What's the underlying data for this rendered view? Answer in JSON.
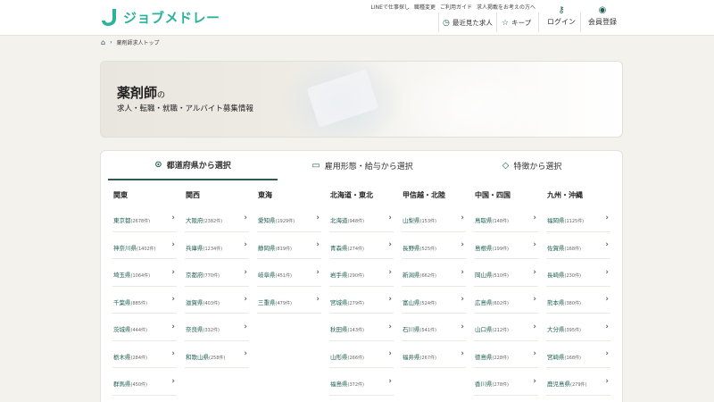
{
  "header": {
    "logo_text": "ジョブメドレー",
    "top_links": [
      "LINEで仕事探し",
      "職種変更",
      "ご利用ガイド",
      "求人掲載をお考えの方へ"
    ],
    "recent_label": "最近見た求人",
    "keep_label": "キープ",
    "login_label": "ログイン",
    "register_label": "会員登録"
  },
  "breadcrumb": {
    "current": "薬剤師求人トップ"
  },
  "hero": {
    "title": "薬剤師",
    "title_suffix": "の",
    "subtitle": "求人・転職・就職・アルバイト募集情報"
  },
  "tabs": [
    {
      "label": "都道府県から選択",
      "icon": "map-pin-icon"
    },
    {
      "label": "雇用形態・給与から選択",
      "icon": "briefcase-icon"
    },
    {
      "label": "特徴から選択",
      "icon": "tag-icon"
    }
  ],
  "regions": [
    {
      "name": "関東",
      "prefs": [
        {
          "name": "東京都",
          "count": "(2678件)"
        },
        {
          "name": "神奈川県",
          "count": "(1402件)"
        },
        {
          "name": "埼玉県",
          "count": "(1064件)"
        },
        {
          "name": "千葉県",
          "count": "(885件)"
        },
        {
          "name": "茨城県",
          "count": "(444件)"
        },
        {
          "name": "栃木県",
          "count": "(284件)"
        },
        {
          "name": "群馬県",
          "count": "(450件)"
        }
      ]
    },
    {
      "name": "関西",
      "prefs": [
        {
          "name": "大阪府",
          "count": "(2382件)"
        },
        {
          "name": "兵庫県",
          "count": "(1234件)"
        },
        {
          "name": "京都府",
          "count": "(770件)"
        },
        {
          "name": "滋賀県",
          "count": "(403件)"
        },
        {
          "name": "奈良県",
          "count": "(332件)"
        },
        {
          "name": "和歌山県",
          "count": "(258件)"
        }
      ]
    },
    {
      "name": "東海",
      "prefs": [
        {
          "name": "愛知県",
          "count": "(1929件)"
        },
        {
          "name": "静岡県",
          "count": "(819件)"
        },
        {
          "name": "岐阜県",
          "count": "(451件)"
        },
        {
          "name": "三重県",
          "count": "(479件)"
        }
      ]
    },
    {
      "name": "北海道・東北",
      "prefs": [
        {
          "name": "北海道",
          "count": "(948件)"
        },
        {
          "name": "青森県",
          "count": "(274件)"
        },
        {
          "name": "岩手県",
          "count": "(290件)"
        },
        {
          "name": "宮城県",
          "count": "(279件)"
        },
        {
          "name": "秋田県",
          "count": "(143件)"
        },
        {
          "name": "山形県",
          "count": "(266件)"
        },
        {
          "name": "福島県",
          "count": "(372件)"
        }
      ]
    },
    {
      "name": "甲信越・北陸",
      "prefs": [
        {
          "name": "山梨県",
          "count": "(153件)"
        },
        {
          "name": "長野県",
          "count": "(525件)"
        },
        {
          "name": "新潟県",
          "count": "(662件)"
        },
        {
          "name": "富山県",
          "count": "(524件)"
        },
        {
          "name": "石川県",
          "count": "(541件)"
        },
        {
          "name": "福井県",
          "count": "(267件)"
        }
      ]
    },
    {
      "name": "中国・四国",
      "prefs": [
        {
          "name": "鳥取県",
          "count": "(148件)"
        },
        {
          "name": "島根県",
          "count": "(199件)"
        },
        {
          "name": "岡山県",
          "count": "(510件)"
        },
        {
          "name": "広島県",
          "count": "(602件)"
        },
        {
          "name": "山口県",
          "count": "(212件)"
        },
        {
          "name": "徳島県",
          "count": "(228件)"
        },
        {
          "name": "香川県",
          "count": "(278件)"
        }
      ]
    },
    {
      "name": "九州・沖縄",
      "prefs": [
        {
          "name": "福岡県",
          "count": "(1125件)"
        },
        {
          "name": "佐賀県",
          "count": "(168件)"
        },
        {
          "name": "長崎県",
          "count": "(230件)"
        },
        {
          "name": "熊本県",
          "count": "(380件)"
        },
        {
          "name": "大分県",
          "count": "(395件)"
        },
        {
          "name": "宮崎県",
          "count": "(168件)"
        },
        {
          "name": "鹿児島県",
          "count": "(279件)"
        }
      ]
    }
  ],
  "colors": {
    "brand": "#2ab39a",
    "accent": "#1d5e52",
    "background": "#f4f2ec"
  }
}
